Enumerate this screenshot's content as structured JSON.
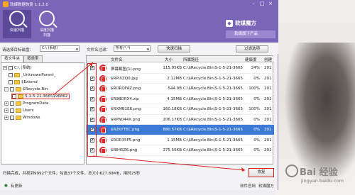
{
  "window": {
    "title": "软媒数据恢复 1.1.2.0"
  },
  "window_controls": [
    "–",
    "□",
    "×"
  ],
  "modes": [
    {
      "label": "快速扫描",
      "icon": "magnifier-icon",
      "active": true
    },
    {
      "label": "深度扫描\n扫描",
      "icon": "deep-scan-icon",
      "active": false
    }
  ],
  "brand": {
    "name": "软媒魔方",
    "product_button": "软媒旗下产品"
  },
  "toolbar": {
    "drive_label": "请选择目标磁盘：",
    "drive_value": "C:\\ (系统)",
    "filter_label": "文件名过滤：",
    "filter_value": "所有(*.*)",
    "scan_button": "快速扫描",
    "filter_option_button": "过滤选项"
  },
  "tree": {
    "tabs": [
      "按文件夹",
      "按类型"
    ],
    "nodes": [
      {
        "label": "C:\\ (系统)",
        "depth": 0,
        "expanded": true
      },
      {
        "label": "_UnknownParent_",
        "depth": 1
      },
      {
        "label": "$Extend",
        "depth": 1
      },
      {
        "label": "$Recycle.Bin",
        "depth": 1,
        "expanded": true
      },
      {
        "label": "S-1-5-21-3665196862",
        "depth": 2,
        "selected": true
      },
      {
        "label": "ProgramData",
        "depth": 1
      },
      {
        "label": "Users",
        "depth": 1
      },
      {
        "label": "Windows",
        "depth": 1
      }
    ]
  },
  "table": {
    "columns": [
      "文件名",
      "大小",
      "所属路径",
      "健康度",
      "创建"
    ],
    "rows": [
      {
        "name": "屏幕截图(1).png",
        "size": "115.95KB",
        "path": "C:\\$Recycle.Bin\\S-1-5-21-3665196862-3...",
        "health": "24%",
        "created": "201"
      },
      {
        "name": "$RPIXZQ0.jpg",
        "size": "2.12MB",
        "path": "C:\\$Recycle.Bin\\S-1-5-21-3665196862-3...",
        "health": "0%",
        "created": "201"
      },
      {
        "name": "$RORQFAZ.png",
        "size": "544.0B",
        "path": "C:\\$Recycle.Bin\\S-1-5-21-3665196862-3...",
        "health": "100%",
        "created": "201"
      },
      {
        "name": "$R9BORX4.zip",
        "size": "4.15MB",
        "path": "C:\\$Recycle.Bin\\S-1-5-21-3665196862-3...",
        "health": "0%",
        "created": "201"
      },
      {
        "name": "$RXMB1E6.png",
        "size": "160.18KB",
        "path": "C:\\$Recycle.Bin\\S-1-5-21-3665196862-3...",
        "health": "100%",
        "created": "201"
      },
      {
        "name": "$RPN044X.png",
        "size": "206.17KB",
        "path": "C:\\$Recycle.Bin\\S-1-5-21-3665196862-3...",
        "health": "0%",
        "created": "201"
      },
      {
        "name": "$R2KYTEC.png",
        "size": "880.57KB",
        "path": "C:\\$Recycle.Bin\\S-1-5-21-3665196862-3...",
        "health": "0%",
        "created": "201",
        "selected": true
      },
      {
        "name": "$ROR35P5.png",
        "size": "1.15MB",
        "path": "C:\\$Recycle.Bin\\S-1-5-21-3665196862-3...",
        "health": "0%",
        "created": "201"
      },
      {
        "name": "$R84SZ6.png",
        "size": "275.56KB",
        "path": "C:\\$Recycle.Bin\\S-1-5-21-3665196862-3...",
        "health": "0%",
        "created": "201"
      }
    ]
  },
  "status": {
    "text": "扫描完成，共找到9992个文件，勾选37个文件，总大小627.89MB，用时25秒",
    "recover_button": "恢复"
  },
  "footer": {
    "update_label": "有更新",
    "link1": "软件官网",
    "link2": "软媒魔方"
  },
  "watermark": {
    "text": "Bai 经验",
    "url": "jingyan.baidu.com"
  },
  "colors": {
    "header": "#7a65b8",
    "selection": "#3c7ad8",
    "highlight": "#e02020"
  }
}
